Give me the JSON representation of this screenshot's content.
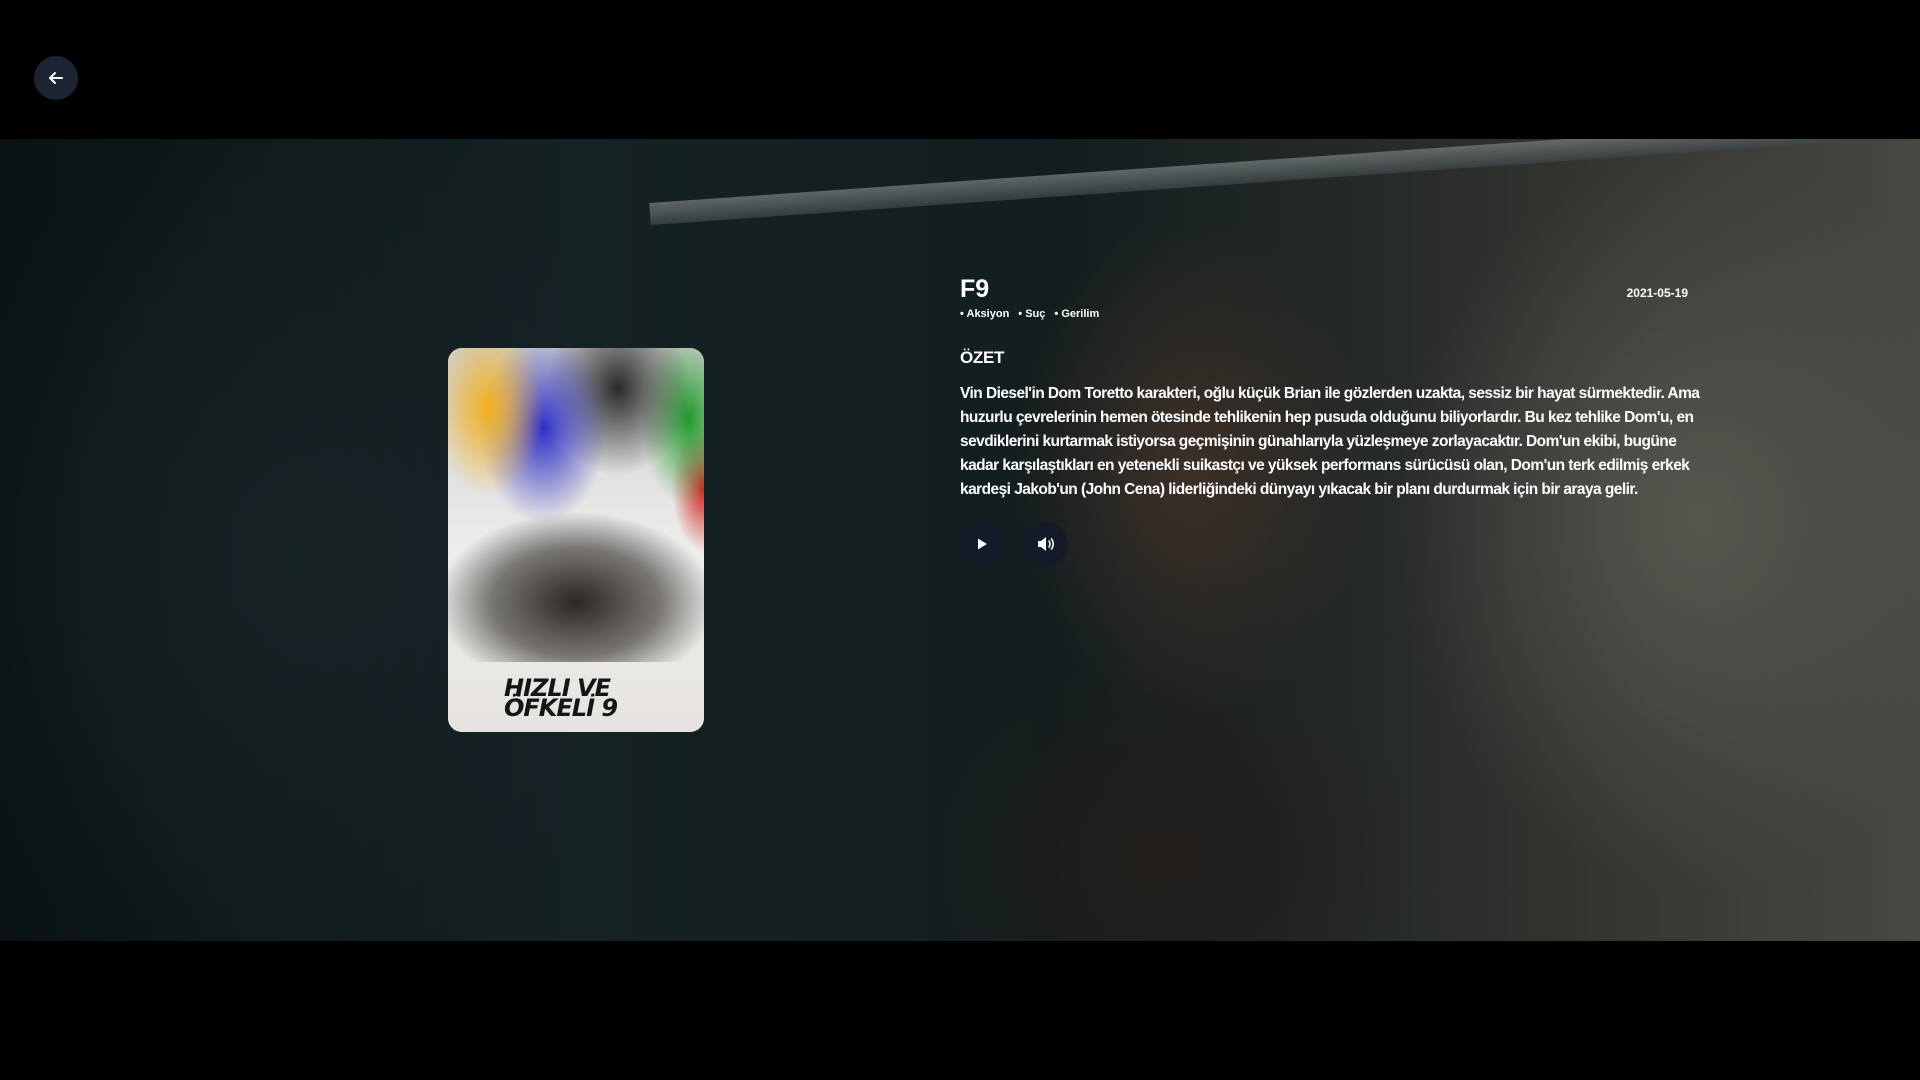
{
  "movie": {
    "title": "F9",
    "release_date": "2021-05-19",
    "genres": [
      "Aksiyon",
      "Suç",
      "Gerilim"
    ],
    "overview_heading": "ÖZET",
    "overview": "Vin Diesel'in Dom Toretto karakteri, oğlu küçük Brian ile gözlerden uzakta, sessiz bir hayat sürmektedir. Ama huzurlu çevrelerinin hemen ötesinde tehlikenin hep pusuda olduğunu biliyorlardır. Bu kez tehlike Dom'u, en sevdiklerini kurtarmak istiyorsa geçmişinin günahlarıyla yüzleşmeye zorlayacaktır. Dom'un ekibi, bugüne kadar karşılaştıkları en yetenekli suikastçı ve yüksek performans sürücüsü olan, Dom'un terk edilmiş erkek kardeşi Jakob'un (John Cena) liderliğindeki dünyayı yıkacak bir planı durdurmak için bir araya gelir.",
    "poster_text": [
      "HIZLI VE",
      "ÖFKELİ 9"
    ]
  },
  "icons": {
    "back": "arrow-left-icon",
    "play": "play-icon",
    "volume": "volume-icon"
  },
  "colors": {
    "button_bg": "#131a28",
    "back_button_bg": "#1c2333"
  }
}
